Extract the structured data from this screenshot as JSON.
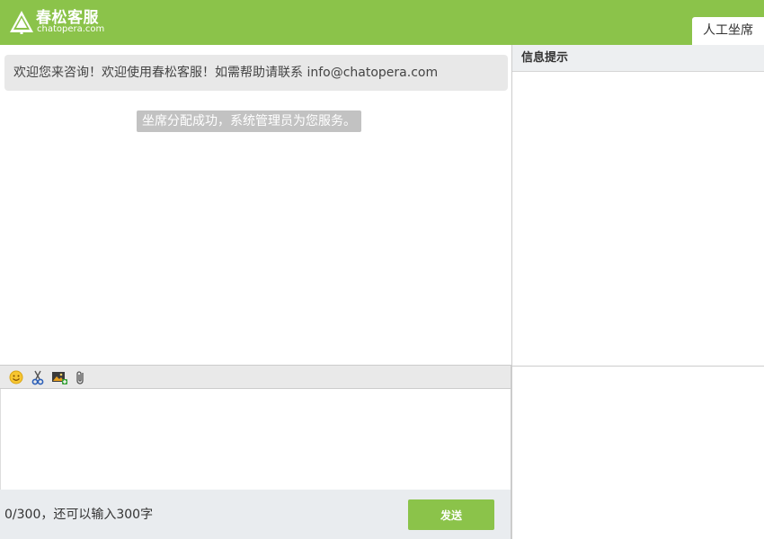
{
  "header": {
    "logo_title": "春松客服",
    "logo_subtitle": "chatopera.com",
    "tab_label": "人工坐席",
    "bg_color": "#8bc34a"
  },
  "chat": {
    "welcome_message": "欢迎您来咨询！欢迎使用春松客服！如需帮助请联系 info@chatopera.com",
    "system_message": "坐席分配成功，系统管理员为您服务。"
  },
  "side_panel": {
    "title": "信息提示"
  },
  "toolbar": {
    "icons": [
      "emoji-icon",
      "scissors-icon",
      "image-upload-icon",
      "paperclip-icon"
    ]
  },
  "input": {
    "value": "",
    "placeholder": ""
  },
  "footer": {
    "counter_text": "0/300，还可以输入300字",
    "send_label": "发送"
  }
}
